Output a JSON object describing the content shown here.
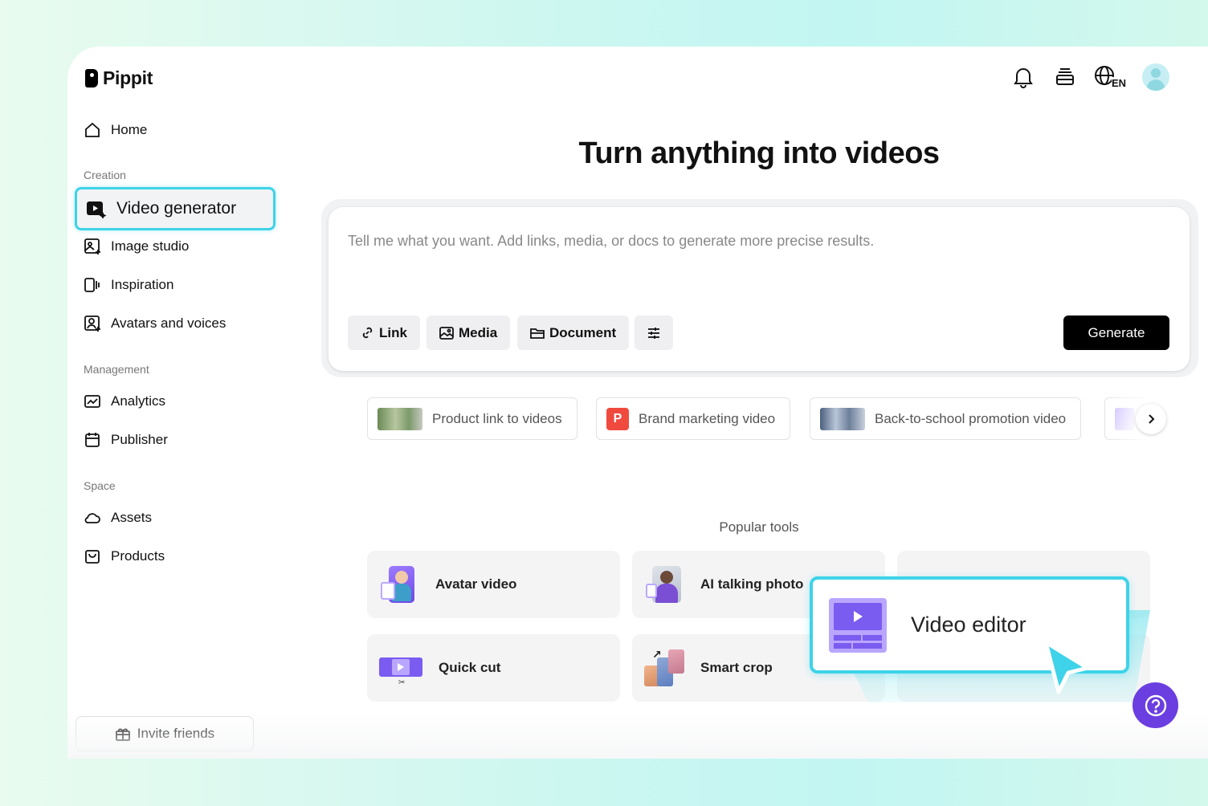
{
  "app": {
    "name": "Pippit"
  },
  "header": {
    "icons": [
      "bell-icon",
      "stack-icon",
      "globe-en-icon",
      "avatar"
    ],
    "language_badge": "EN"
  },
  "sidebar": {
    "home": "Home",
    "sections": {
      "creation": "Creation",
      "management": "Management",
      "space": "Space"
    },
    "items": {
      "video_generator": "Video generator",
      "image_studio": "Image studio",
      "inspiration": "Inspiration",
      "avatars_voices": "Avatars and voices",
      "analytics": "Analytics",
      "publisher": "Publisher",
      "assets": "Assets",
      "products": "Products"
    },
    "invite": "Invite friends",
    "accent_color": "#3ed3e8"
  },
  "main": {
    "title": "Turn anything into videos",
    "prompt": {
      "placeholder": "Tell me what you want. Add links, media, or docs to generate more precise results.",
      "link_label": "Link",
      "media_label": "Media",
      "document_label": "Document",
      "generate_label": "Generate"
    },
    "chips": [
      {
        "label": "Product link to videos"
      },
      {
        "label": "Brand marketing video",
        "badge": "P"
      },
      {
        "label": "Back-to-school promotion video"
      }
    ],
    "popular_tools_label": "Popular tools",
    "tools": {
      "avatar_video": "Avatar video",
      "ai_talking_photo": "AI talking photo",
      "quick_cut": "Quick cut",
      "smart_crop": "Smart crop",
      "video_editor": "Video editor"
    },
    "tool_colors": {
      "purple": "#7b5cf0",
      "help": "#6a3ee0"
    }
  }
}
